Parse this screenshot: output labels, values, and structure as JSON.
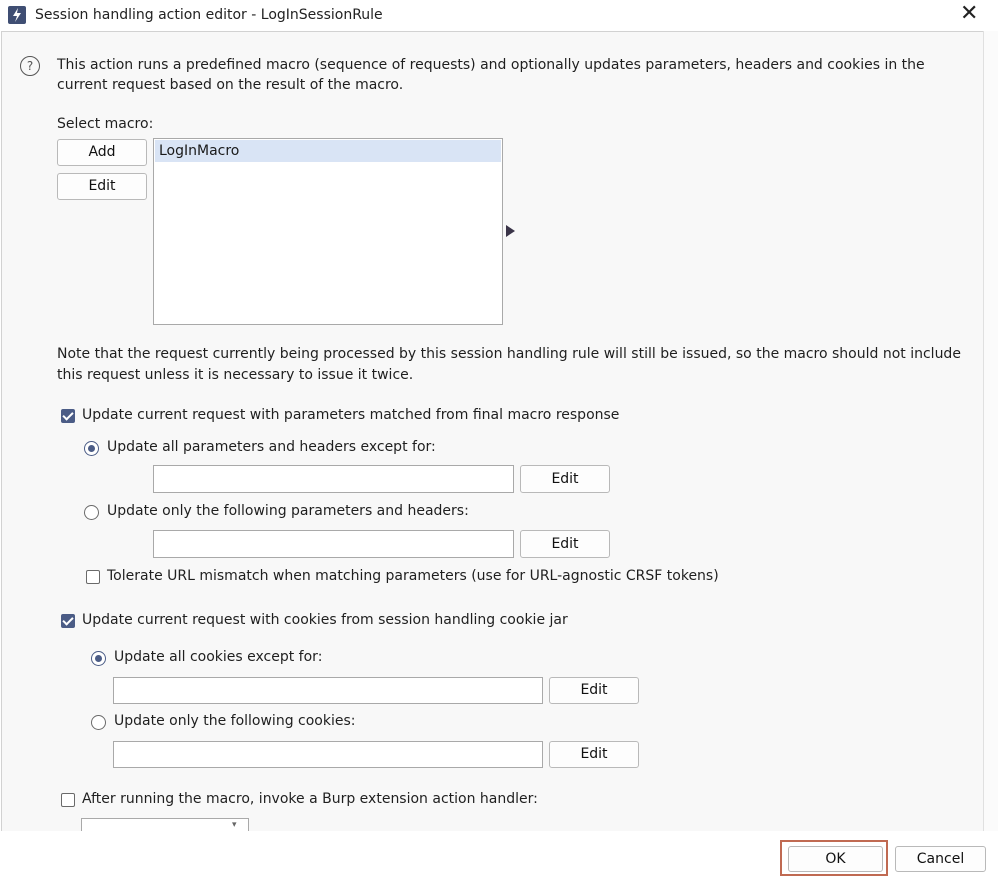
{
  "window": {
    "title": "Session handling action editor - LogInSessionRule"
  },
  "description": "This action runs a predefined macro (sequence of requests) and optionally updates parameters, headers and cookies in the current request based on the result of the macro.",
  "macro": {
    "label": "Select macro:",
    "add_label": "Add",
    "edit_label": "Edit",
    "items": [
      "LogInMacro"
    ],
    "selected": "LogInMacro"
  },
  "note": "Note that the request currently being processed by this session handling rule will still be issued, so the macro should not include this request unless it is necessary to issue it twice.",
  "params": {
    "checkbox_label": "Update current request with parameters matched from final macro response",
    "checked": true,
    "option_all_label": "Update all parameters and headers except for:",
    "option_all_value": "",
    "option_only_label": "Update only the following parameters and headers:",
    "option_only_value": "",
    "selected_option": "all",
    "edit_label": "Edit",
    "tolerate_label": "Tolerate URL mismatch when matching parameters (use for URL-agnostic CRSF tokens)",
    "tolerate_checked": false
  },
  "cookies": {
    "checkbox_label": "Update current request with cookies from session handling cookie jar",
    "checked": true,
    "option_all_label": "Update all cookies except for:",
    "option_all_value": "",
    "option_only_label": "Update only the following cookies:",
    "option_only_value": "",
    "selected_option": "all",
    "edit_label": "Edit"
  },
  "extension": {
    "checkbox_label": "After running the macro, invoke a Burp extension action handler:",
    "checked": false
  },
  "footer": {
    "ok_label": "OK",
    "cancel_label": "Cancel"
  },
  "icons": {
    "app": "burp-lightning-icon",
    "close": "close-icon",
    "help": "help-icon",
    "arrow": "arrow-right-icon"
  },
  "colors": {
    "accent": "#4b5c86",
    "selection": "#d9e4f5",
    "ok_highlight": "#c06a52"
  }
}
